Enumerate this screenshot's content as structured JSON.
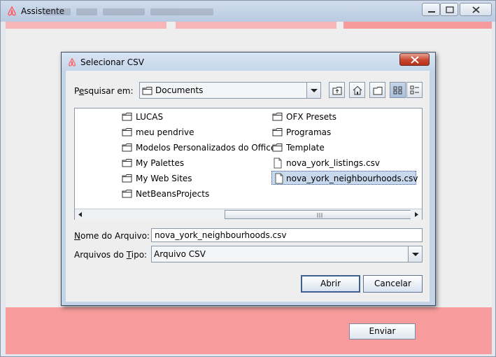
{
  "window": {
    "title": "Assistente"
  },
  "dialog": {
    "title": "Selecionar CSV",
    "look_in_label_pre": "P",
    "look_in_label_ul": "e",
    "look_in_label_post": "squisar em:",
    "look_in_value": "Documents",
    "toolbar_icons": [
      "up-one-level-icon",
      "home-icon",
      "new-folder-icon",
      "list-view-icon",
      "details-view-icon"
    ],
    "files": [
      {
        "name": "LUCAS",
        "type": "folder"
      },
      {
        "name": "meu pendrive",
        "type": "folder"
      },
      {
        "name": "Modelos Personalizados do Office",
        "type": "folder"
      },
      {
        "name": "My Palettes",
        "type": "folder"
      },
      {
        "name": "My Web Sites",
        "type": "folder"
      },
      {
        "name": "NetBeansProjects",
        "type": "folder"
      },
      {
        "name": "OFX Presets",
        "type": "folder"
      },
      {
        "name": "Programas",
        "type": "folder"
      },
      {
        "name": "Template",
        "type": "folder"
      },
      {
        "name": "nova_york_listings.csv",
        "type": "file"
      },
      {
        "name": "nova_york_neighbourhoods.csv",
        "type": "file",
        "selected": true
      }
    ],
    "filename_label_ul": "N",
    "filename_label_post": "ome do Arquivo:",
    "filename_value": "nova_york_neighbourhoods.csv",
    "filetype_label_pre": "Arquivos do ",
    "filetype_label_ul": "T",
    "filetype_label_post": "ipo:",
    "filetype_value": "Arquivo CSV",
    "open_button": "Abrir",
    "cancel_button": "Cancelar"
  },
  "main": {
    "send_button": "Enviar"
  },
  "colors": {
    "accent_pink": "#f79b9c",
    "selection": "#c8d9ee"
  }
}
